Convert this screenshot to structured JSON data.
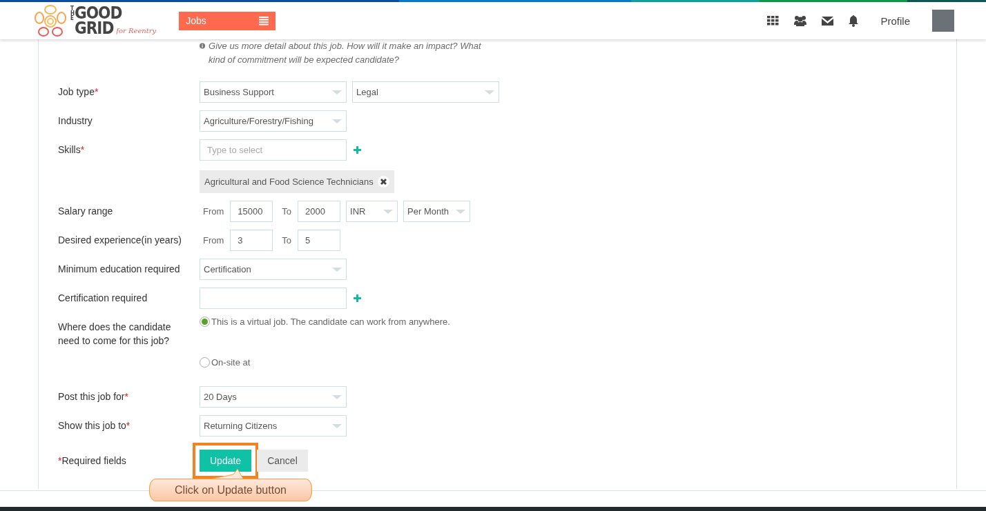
{
  "header": {
    "logo": {
      "stacked": "THE",
      "top": "GOOD",
      "bottom": "GRID",
      "tagline": "for Reentry"
    },
    "menu": {
      "label": "Jobs"
    },
    "profile": "Profile"
  },
  "form": {
    "hint": "Give us more detail about this job. How will it make an impact? What kind of commitment will be expected candidate?",
    "rows": [
      {
        "label": "Job type",
        "required_mark": "*",
        "controls": [
          {
            "kind": "select",
            "value": "Business Support"
          },
          {
            "kind": "select",
            "value": "Legal"
          }
        ]
      },
      {
        "label": "Industry",
        "controls": [
          {
            "kind": "select",
            "value": "Agriculture/Forestry/Fishing"
          }
        ]
      },
      {
        "label": "Skills",
        "required_mark": "*",
        "controls": [
          {
            "kind": "input",
            "placeholder": "Type to select"
          },
          {
            "kind": "add"
          }
        ]
      },
      {
        "controls": [
          {
            "kind": "tag",
            "value": "Agricultural and Food Science Technicians"
          }
        ]
      },
      {
        "label": "Salary range",
        "controls": [
          {
            "kind": "text",
            "value": "From"
          },
          {
            "kind": "number",
            "value": "15000"
          },
          {
            "kind": "text",
            "value": "To"
          },
          {
            "kind": "number",
            "value": "2000"
          },
          {
            "kind": "unit",
            "value": "INR"
          },
          {
            "kind": "unit",
            "value": "Per Month"
          }
        ]
      },
      {
        "label": "Desired experience(in years)",
        "controls": [
          {
            "kind": "text",
            "value": "From"
          },
          {
            "kind": "number",
            "value": "3"
          },
          {
            "kind": "text",
            "value": "To"
          },
          {
            "kind": "number",
            "value": "5"
          }
        ]
      },
      {
        "label": "Minimum education required",
        "controls": [
          {
            "kind": "select",
            "value": "Certification"
          }
        ]
      },
      {
        "label": "Certification required",
        "controls": [
          {
            "kind": "input"
          },
          {
            "kind": "add"
          }
        ]
      },
      {
        "label": "Where does the candidate need to come for this job?",
        "controls": [
          {
            "kind": "radio",
            "value": "This is a virtual job. The candidate can work from anywhere.",
            "selected": true
          }
        ]
      },
      {
        "controls": [
          {
            "kind": "radio",
            "value": "On-site at",
            "selected": false
          }
        ]
      },
      {
        "label": "Post this job for",
        "required_mark": "*",
        "controls": [
          {
            "kind": "select",
            "value": "20 Days"
          }
        ]
      },
      {
        "label": "Show this job to",
        "required_mark": "*",
        "controls": [
          {
            "kind": "select",
            "value": "Returning Citizens"
          }
        ]
      }
    ],
    "required_note": {
      "mark": "*",
      "text": "Required fields"
    },
    "buttons": [
      {
        "label": "Update",
        "kind": "primary",
        "highlighted": true
      },
      {
        "label": "Cancel",
        "kind": "secondary",
        "highlighted": false
      }
    ],
    "callout": "Click on Update button"
  }
}
